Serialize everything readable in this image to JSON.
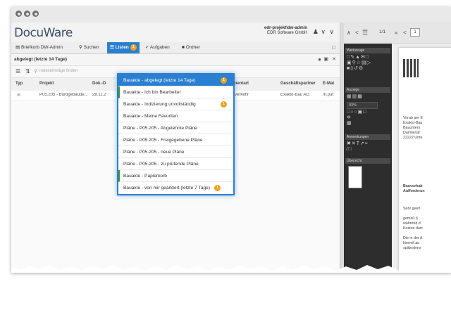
{
  "app": {
    "logo": "DocuWare",
    "user_line1": "edr-projekt\\dw-admin",
    "user_line2": "EDR Software GmbH"
  },
  "tabs": [
    {
      "label": "Briefkorb DW-Admin"
    },
    {
      "label": "Suchen"
    },
    {
      "label": "Listen",
      "badge": "1"
    },
    {
      "label": "Aufgaben"
    },
    {
      "label": "Ordner"
    }
  ],
  "list": {
    "title": "abgelegt (letzte 14 Tage)",
    "search_placeholder": "Indexeinträge finden"
  },
  "table": {
    "columns": [
      "Typ",
      "Projekt",
      "Dok.-D",
      "Dokumentart",
      "Geschäftspartner",
      "E-Mai"
    ],
    "rows": [
      {
        "projekt": "P05.205 - Bürogebäude...",
        "datum": "29.11.2",
        "dokumentart": "Schriftverkehr",
        "partner": "Exakto-Bau AG",
        "email": "m.put"
      }
    ]
  },
  "dropdown": {
    "items": [
      {
        "label": "Bauakte - abgelegt (letzte 14 Tage)",
        "badge": "1"
      },
      {
        "label": "Bauakte - Ich bin Bearbeiter"
      },
      {
        "label": "Bauakte - Indizierung unvollständig",
        "badge": "1"
      },
      {
        "label": "Bauakte - Meine Favoriten"
      },
      {
        "label": "Pläne - P05.205 - Abgelehnte Pläne"
      },
      {
        "label": "Pläne - P05.205 - Freigegebene Pläne"
      },
      {
        "label": "Pläne - P05.205 - neue Pläne"
      },
      {
        "label": "Pläne - P05.205 - zu prüfende Pläne"
      },
      {
        "label": "Bauakte - Papierkorb"
      },
      {
        "label": "Bauakte - von mir geändert (letzte 7 Tage)",
        "badge": "1"
      }
    ]
  },
  "tools": {
    "sections": [
      "Werkzeuge",
      "Anzeige",
      "Anmerkungen",
      "Übersicht"
    ],
    "zoom": "93%"
  },
  "viewer": {
    "page_indicator": "1/1",
    "page_input": "1",
    "doc_lines": [
      "Vorab per E",
      "Exakto-Bau",
      "Bauuntern",
      "Daimlerstr",
      "22222 Unte",
      "Bauvorhab",
      "Aufforderun",
      "Sehr geeh",
      "gemäß § ",
      "während d",
      "Kosten durc",
      "Die in der A",
      "hiermit au",
      "spätestens"
    ]
  }
}
